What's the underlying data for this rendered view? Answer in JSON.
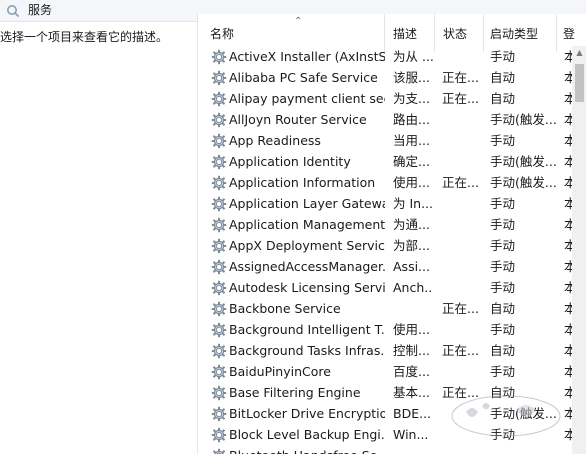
{
  "window": {
    "title": "服务"
  },
  "left_pane": {
    "description_prompt": "选择一个项目来查看它的描述。"
  },
  "columns": {
    "name": "名称",
    "description": "描述",
    "status": "状态",
    "startup_type": "启动类型",
    "logon_as": "登"
  },
  "services": [
    {
      "name": "ActiveX Installer (AxInstSV)",
      "description": "为从 ...",
      "status": "",
      "startup": "手动",
      "logon": "本"
    },
    {
      "name": "Alibaba PC Safe Service",
      "description": "该服...",
      "status": "正在...",
      "startup": "自动",
      "logon": "本"
    },
    {
      "name": "Alipay payment client sec...",
      "description": "为支...",
      "status": "正在...",
      "startup": "自动",
      "logon": "本"
    },
    {
      "name": "AllJoyn Router Service",
      "description": "路由...",
      "status": "",
      "startup": "手动(触发...",
      "logon": "本"
    },
    {
      "name": "App Readiness",
      "description": "当用...",
      "status": "",
      "startup": "手动",
      "logon": "本"
    },
    {
      "name": "Application Identity",
      "description": "确定...",
      "status": "",
      "startup": "手动(触发...",
      "logon": "本"
    },
    {
      "name": "Application Information",
      "description": "使用...",
      "status": "正在...",
      "startup": "手动(触发...",
      "logon": "本"
    },
    {
      "name": "Application Layer Gatewa...",
      "description": "为 In...",
      "status": "",
      "startup": "手动",
      "logon": "本"
    },
    {
      "name": "Application Management",
      "description": "为通...",
      "status": "",
      "startup": "手动",
      "logon": "本"
    },
    {
      "name": "AppX Deployment Servic...",
      "description": "为部...",
      "status": "",
      "startup": "手动",
      "logon": "本"
    },
    {
      "name": "AssignedAccessManager...",
      "description": "Assi...",
      "status": "",
      "startup": "手动",
      "logon": "本"
    },
    {
      "name": "Autodesk Licensing Servi...",
      "description": "Anch...",
      "status": "",
      "startup": "手动",
      "logon": "本"
    },
    {
      "name": "Backbone Service",
      "description": "",
      "status": "正在...",
      "startup": "自动",
      "logon": "本"
    },
    {
      "name": "Background Intelligent T...",
      "description": "使用...",
      "status": "",
      "startup": "手动",
      "logon": "本"
    },
    {
      "name": "Background Tasks Infras...",
      "description": "控制...",
      "status": "正在...",
      "startup": "自动",
      "logon": "本"
    },
    {
      "name": "BaiduPinyinCore",
      "description": "百度...",
      "status": "",
      "startup": "手动",
      "logon": "本"
    },
    {
      "name": "Base Filtering Engine",
      "description": "基本...",
      "status": "正在...",
      "startup": "自动",
      "logon": "本"
    },
    {
      "name": "BitLocker Drive Encryptio...",
      "description": "BDE...",
      "status": "",
      "startup": "手动(触发...",
      "logon": "本"
    },
    {
      "name": "Block Level Backup Engi...",
      "description": "Win...",
      "status": "",
      "startup": "手动",
      "logon": "本"
    },
    {
      "name": "Bluetooth Handsfree Se...",
      "description": "",
      "status": "",
      "startup": "",
      "logon": ""
    }
  ],
  "colors": {
    "header_band": "#f4f6f9",
    "gear": "#7f8a98",
    "selection": "#e5f3ff"
  },
  "icons": {
    "title": "search-icon",
    "service": "gear-icon"
  }
}
